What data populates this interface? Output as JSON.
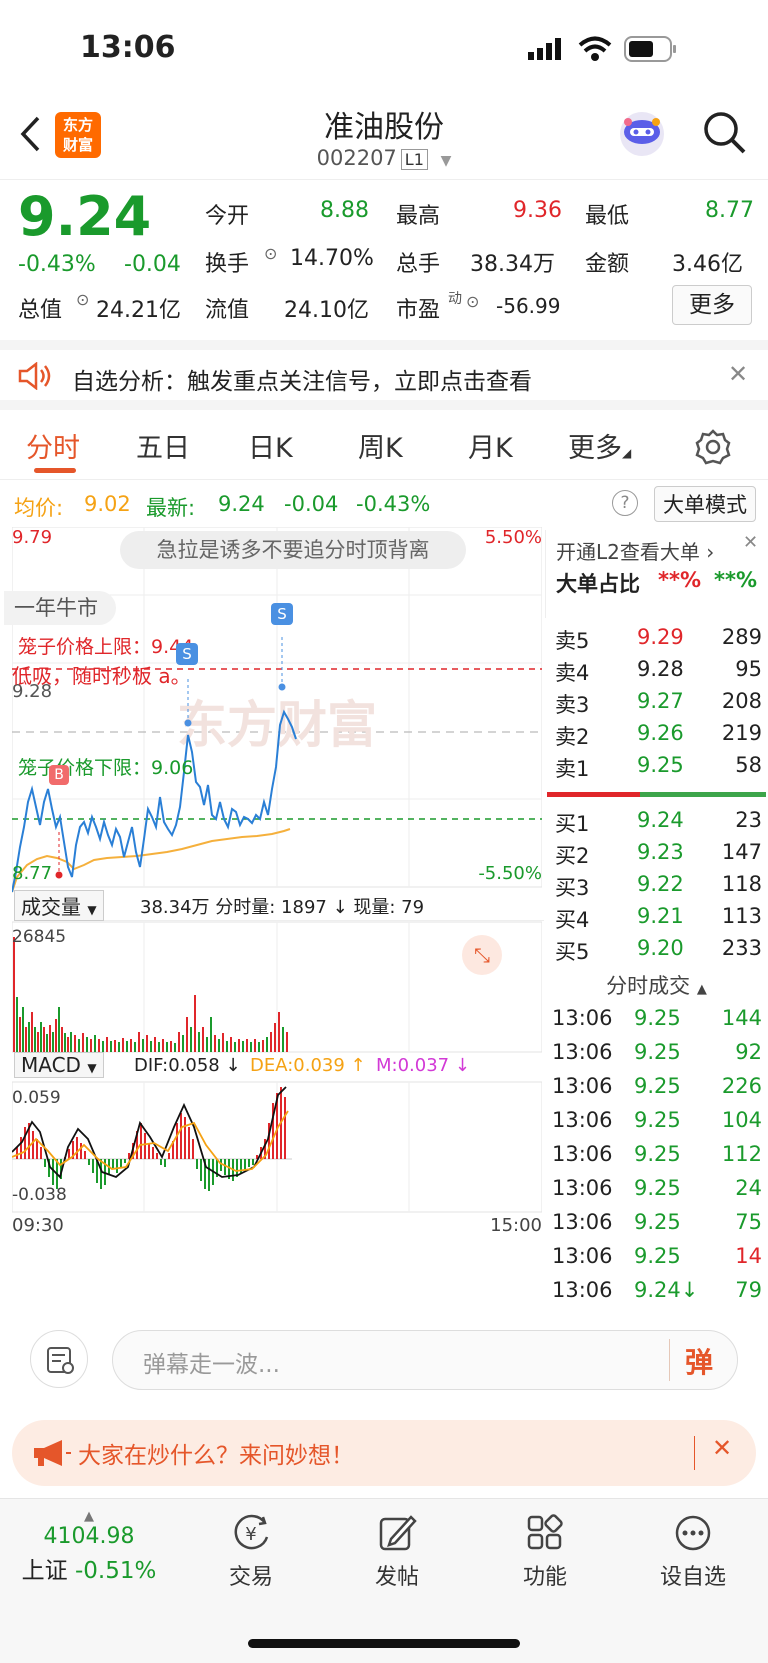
{
  "status": {
    "time": "13:06"
  },
  "header": {
    "logo": [
      "东方",
      "财富"
    ],
    "name": "准油股份",
    "code": "002207",
    "level": "L1"
  },
  "quote": {
    "price": "9.24",
    "change_pct": "-0.43%",
    "change": "-0.04",
    "open_label": "今开",
    "open": "8.88",
    "high_label": "最高",
    "high": "9.36",
    "low_label": "最低",
    "low": "8.77",
    "turnover_label": "换手",
    "turnover": "14.70%",
    "volume_label": "总手",
    "volume": "38.34万",
    "amount_label": "金额",
    "amount": "3.46亿",
    "mktcap_label": "总值",
    "mktcap": "24.21亿",
    "float_label": "流值",
    "float": "24.10亿",
    "pe_label": "市盈",
    "pe_sup": "动",
    "pe": "-56.99",
    "more": "更多"
  },
  "signal": {
    "text": "自选分析：触发重点关注信号，立即点击查看"
  },
  "tabs": [
    "分时",
    "五日",
    "日K",
    "周K",
    "月K",
    "更多"
  ],
  "infobar": {
    "avg_label": "均价:",
    "avg": "9.02",
    "last_label": "最新:",
    "last": "9.24",
    "chg": "-0.04",
    "pct": "-0.43%",
    "mode": "大单模式"
  },
  "chart": {
    "y_top": "9.79",
    "y_bottom": "8.77",
    "pct_top": "5.50%",
    "pct_bottom": "-5.50%",
    "ref_label": "9.28",
    "tip": "急拉是诱多不要追分时顶背离",
    "tag": "一年牛市",
    "cage_upper": "笼子价格上限：9.44",
    "cage_lower": "笼子价格下限：9.06",
    "overlay": "低吸，随时秒板 a。",
    "watermark": "东方财富",
    "vol_selector": "成交量",
    "vol_info": "38.34万 分时量: 1897 ↓ 现量: 79",
    "vol_max": "26845",
    "macd_selector": "MACD",
    "dif": "DIF:0.058 ↓",
    "dea": "DEA:0.039 ↑",
    "m": "M:0.037 ↓",
    "macd_top": "0.059",
    "macd_bottom": "-0.038",
    "t_start": "09:30",
    "t_end": "15:00"
  },
  "side": {
    "l2": "开通L2查看大单",
    "big_ratio_label": "大单占比",
    "big_a": "**%",
    "big_b": "**%",
    "asks": [
      {
        "label": "卖5",
        "price": "9.29",
        "vol": "289"
      },
      {
        "label": "卖4",
        "price": "9.28",
        "vol": "95"
      },
      {
        "label": "卖3",
        "price": "9.27",
        "vol": "208"
      },
      {
        "label": "卖2",
        "price": "9.26",
        "vol": "219"
      },
      {
        "label": "卖1",
        "price": "9.25",
        "vol": "58"
      }
    ],
    "bids": [
      {
        "label": "买1",
        "price": "9.24",
        "vol": "23"
      },
      {
        "label": "买2",
        "price": "9.23",
        "vol": "147"
      },
      {
        "label": "买3",
        "price": "9.22",
        "vol": "118"
      },
      {
        "label": "买4",
        "price": "9.21",
        "vol": "113"
      },
      {
        "label": "买5",
        "price": "9.20",
        "vol": "233"
      }
    ],
    "ticks_title": "分时成交",
    "ticks": [
      {
        "t": "13:06",
        "p": "9.25",
        "v": "144",
        "c": "green"
      },
      {
        "t": "13:06",
        "p": "9.25",
        "v": "92",
        "c": "green"
      },
      {
        "t": "13:06",
        "p": "9.25",
        "v": "226",
        "c": "green"
      },
      {
        "t": "13:06",
        "p": "9.25",
        "v": "104",
        "c": "green"
      },
      {
        "t": "13:06",
        "p": "9.25",
        "v": "112",
        "c": "green"
      },
      {
        "t": "13:06",
        "p": "9.25",
        "v": "24",
        "c": "green"
      },
      {
        "t": "13:06",
        "p": "9.25",
        "v": "75",
        "c": "green"
      },
      {
        "t": "13:06",
        "p": "9.25",
        "v": "14",
        "c": "red"
      },
      {
        "t": "13:06",
        "p": "9.24↓",
        "v": "79",
        "c": "green"
      }
    ]
  },
  "input": {
    "placeholder": "弹幕走一波...",
    "danmu": "弹"
  },
  "ask": {
    "text": "大家在炒什么？来问妙想！"
  },
  "bottom": {
    "index_value": "4104.98",
    "index_name": "上证",
    "index_pct": "-0.51%",
    "items": [
      "交易",
      "发帖",
      "功能",
      "设自选"
    ]
  }
}
